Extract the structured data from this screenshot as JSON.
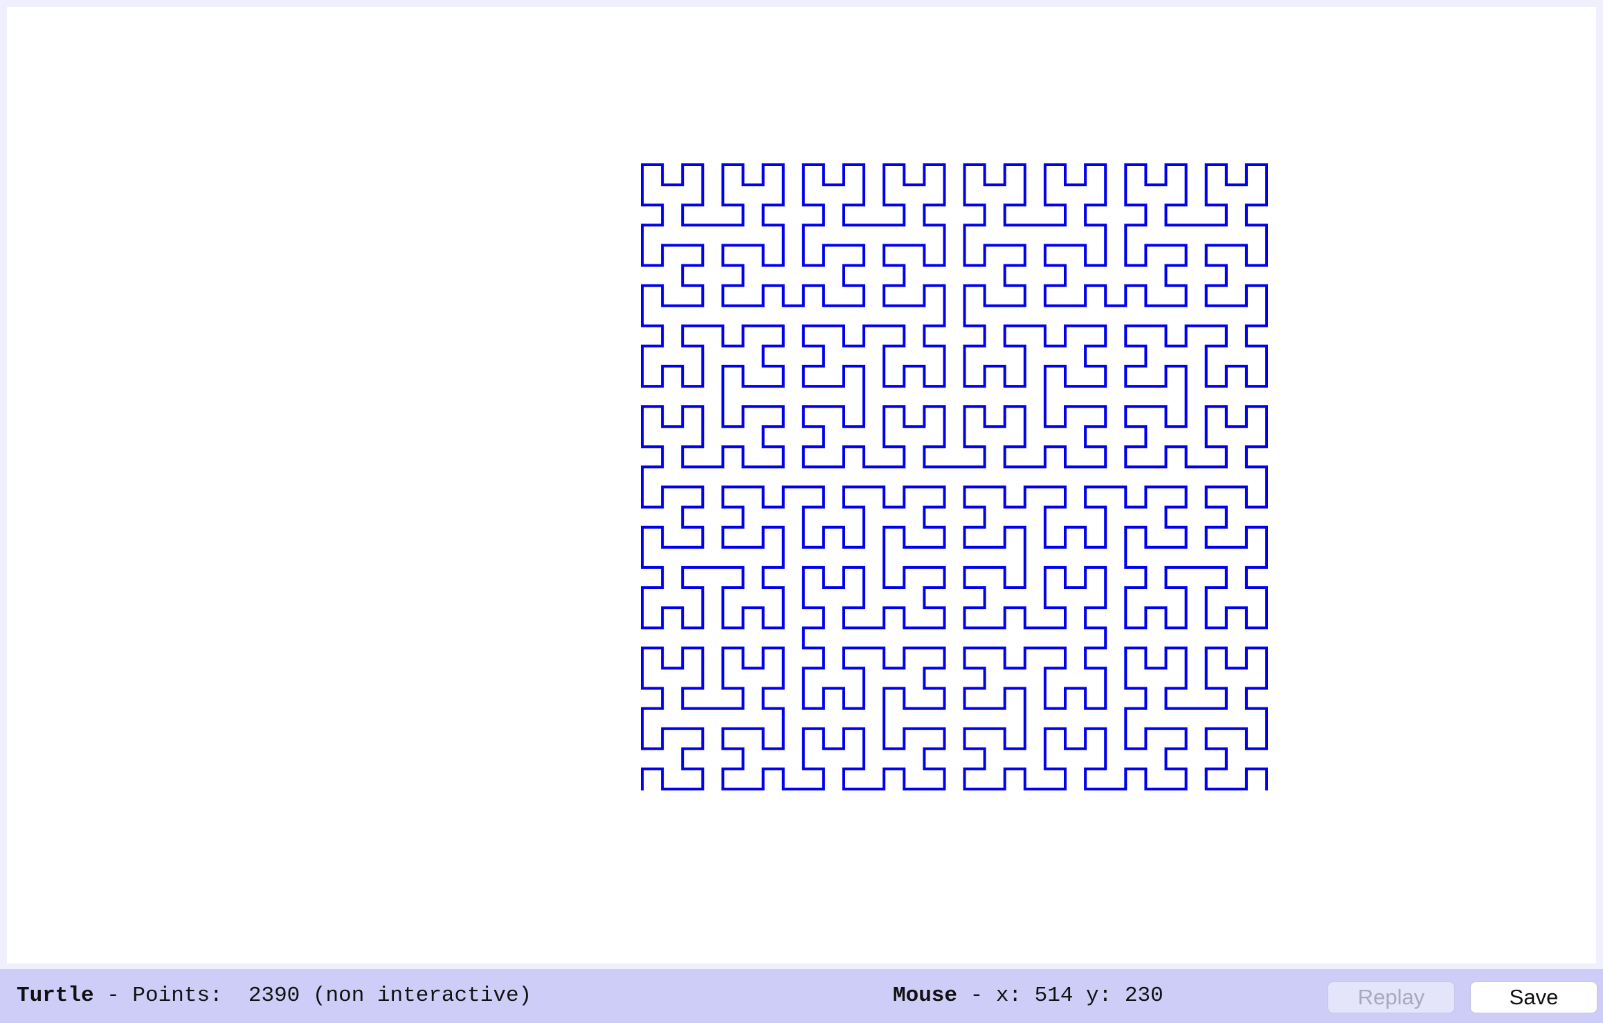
{
  "drawing": {
    "curve": "hilbert",
    "order": 5,
    "stroke_color": "#0000ee"
  },
  "status": {
    "turtle_label": "Turtle",
    "points_label": " - Points:  ",
    "points_value": "2390",
    "points_mode": " (non interactive)",
    "mouse_label": "Mouse",
    "mouse_sep": " - x: ",
    "mouse_x": "514",
    "mouse_y_label": " y: ",
    "mouse_y": "230"
  },
  "buttons": {
    "replay_label": "Replay",
    "save_label": "Save"
  },
  "colors": {
    "page_bg": "#efeffd",
    "canvas_bg": "#ffffff",
    "status_bg": "#cdcdf8"
  }
}
